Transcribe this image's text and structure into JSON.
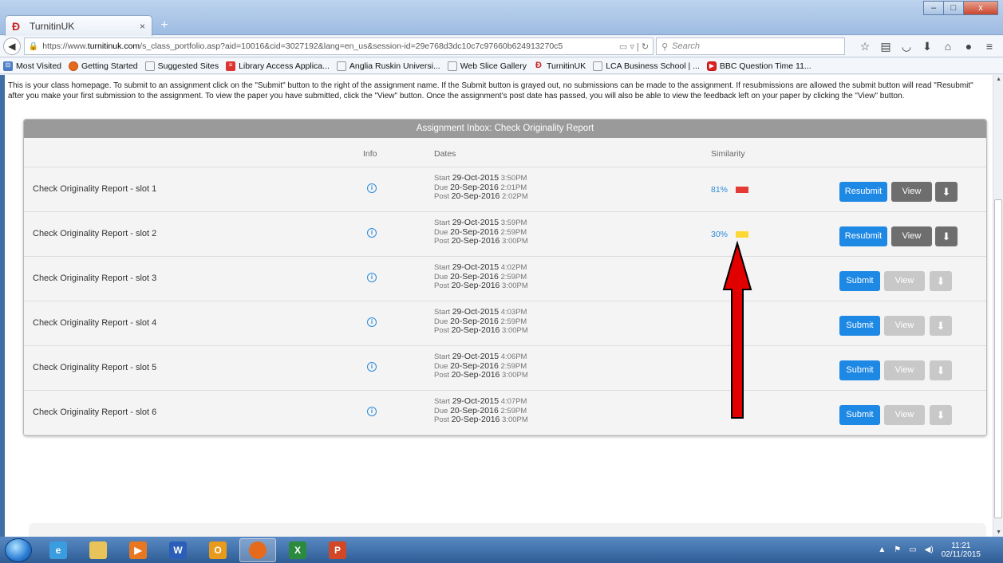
{
  "browser": {
    "tab_title": "TurnitinUK",
    "tab_close": "×",
    "new_tab": "+",
    "url_prefix": "https://www.",
    "url_domain": "turnitinuk.com",
    "url_rest": "/s_class_portfolio.asp?aid=10016&cid=3027192&lang=en_us&session-id=29e768d3dc10c7c97660b624913270c5",
    "search_placeholder": "Search",
    "window_controls": {
      "minimize": "–",
      "maximize": "□",
      "close": "x"
    }
  },
  "bookmarks": [
    {
      "label": "Most Visited",
      "icon": "mostvisited-icon"
    },
    {
      "label": "Getting Started",
      "icon": "firefox-icon"
    },
    {
      "label": "Suggested Sites",
      "icon": "page-icon"
    },
    {
      "label": "Library Access Applica...",
      "icon": "library-icon"
    },
    {
      "label": "Anglia Ruskin Universi...",
      "icon": "page-icon"
    },
    {
      "label": "Web Slice Gallery",
      "icon": "page-icon"
    },
    {
      "label": "TurnitinUK",
      "icon": "turnitin-icon"
    },
    {
      "label": "LCA Business School | ...",
      "icon": "page-icon"
    },
    {
      "label": "BBC Question Time 11...",
      "icon": "youtube-icon"
    }
  ],
  "intro_text": "This is your class homepage. To submit to an assignment click on the \"Submit\" button to the right of the assignment name. If the Submit button is grayed out, no submissions can be made to the assignment. If resubmissions are allowed the submit button will read \"Resubmit\" after you make your first submission to the assignment. To view the paper you have submitted, click the \"View\" button. Once the assignment's post date has passed, you will also be able to view the feedback left on your paper by clicking the \"View\" button.",
  "inbox": {
    "title": "Assignment Inbox: Check Originality Report",
    "columns": {
      "info": "Info",
      "dates": "Dates",
      "similarity": "Similarity"
    },
    "labels": {
      "start": "Start",
      "due": "Due",
      "post": "Post",
      "view": "View",
      "resubmit": "Resubmit",
      "submit": "Submit"
    },
    "rows": [
      {
        "title": "Check Originality Report - slot 1",
        "start_date": "29-Oct-2015",
        "start_time": "3:50PM",
        "due_date": "20-Sep-2016",
        "due_time": "2:01PM",
        "post_date": "20-Sep-2016",
        "post_time": "2:02PM",
        "similarity": "81%",
        "sim_color": "#e53935",
        "action": "Resubmit"
      },
      {
        "title": "Check Originality Report - slot 2",
        "start_date": "29-Oct-2015",
        "start_time": "3:59PM",
        "due_date": "20-Sep-2016",
        "due_time": "2:59PM",
        "post_date": "20-Sep-2016",
        "post_time": "3:00PM",
        "similarity": "30%",
        "sim_color": "#fdd835",
        "action": "Resubmit"
      },
      {
        "title": "Check Originality Report - slot 3",
        "start_date": "29-Oct-2015",
        "start_time": "4:02PM",
        "due_date": "20-Sep-2016",
        "due_time": "2:59PM",
        "post_date": "20-Sep-2016",
        "post_time": "3:00PM",
        "similarity": "",
        "sim_color": "",
        "action": "Submit"
      },
      {
        "title": "Check Originality Report - slot 4",
        "start_date": "29-Oct-2015",
        "start_time": "4:03PM",
        "due_date": "20-Sep-2016",
        "due_time": "2:59PM",
        "post_date": "20-Sep-2016",
        "post_time": "3:00PM",
        "similarity": "",
        "sim_color": "",
        "action": "Submit"
      },
      {
        "title": "Check Originality Report - slot 5",
        "start_date": "29-Oct-2015",
        "start_time": "4:06PM",
        "due_date": "20-Sep-2016",
        "due_time": "2:59PM",
        "post_date": "20-Sep-2016",
        "post_time": "3:00PM",
        "similarity": "",
        "sim_color": "",
        "action": "Submit"
      },
      {
        "title": "Check Originality Report - slot 6",
        "start_date": "29-Oct-2015",
        "start_time": "4:07PM",
        "due_date": "20-Sep-2016",
        "due_time": "2:59PM",
        "post_date": "20-Sep-2016",
        "post_time": "3:00PM",
        "similarity": "",
        "sim_color": "",
        "action": "Submit"
      }
    ]
  },
  "annotation": {
    "arrow_color": "#e00000"
  },
  "taskbar": {
    "apps": [
      {
        "name": "ie-icon",
        "glyph": "e",
        "color": "#3a9de0"
      },
      {
        "name": "explorer-icon",
        "glyph": "",
        "color": "#e8c35a"
      },
      {
        "name": "media-icon",
        "glyph": "▶",
        "color": "#e87722"
      },
      {
        "name": "word-icon",
        "glyph": "W",
        "color": "#2b5eb8"
      },
      {
        "name": "outlook-icon",
        "glyph": "O",
        "color": "#e89a1c"
      },
      {
        "name": "firefox-icon",
        "glyph": "",
        "color": "#e66a1c"
      },
      {
        "name": "excel-icon",
        "glyph": "X",
        "color": "#2a8a3e"
      },
      {
        "name": "powerpoint-icon",
        "glyph": "P",
        "color": "#d24726"
      }
    ],
    "time": "11:21",
    "date": "02/11/2015"
  }
}
